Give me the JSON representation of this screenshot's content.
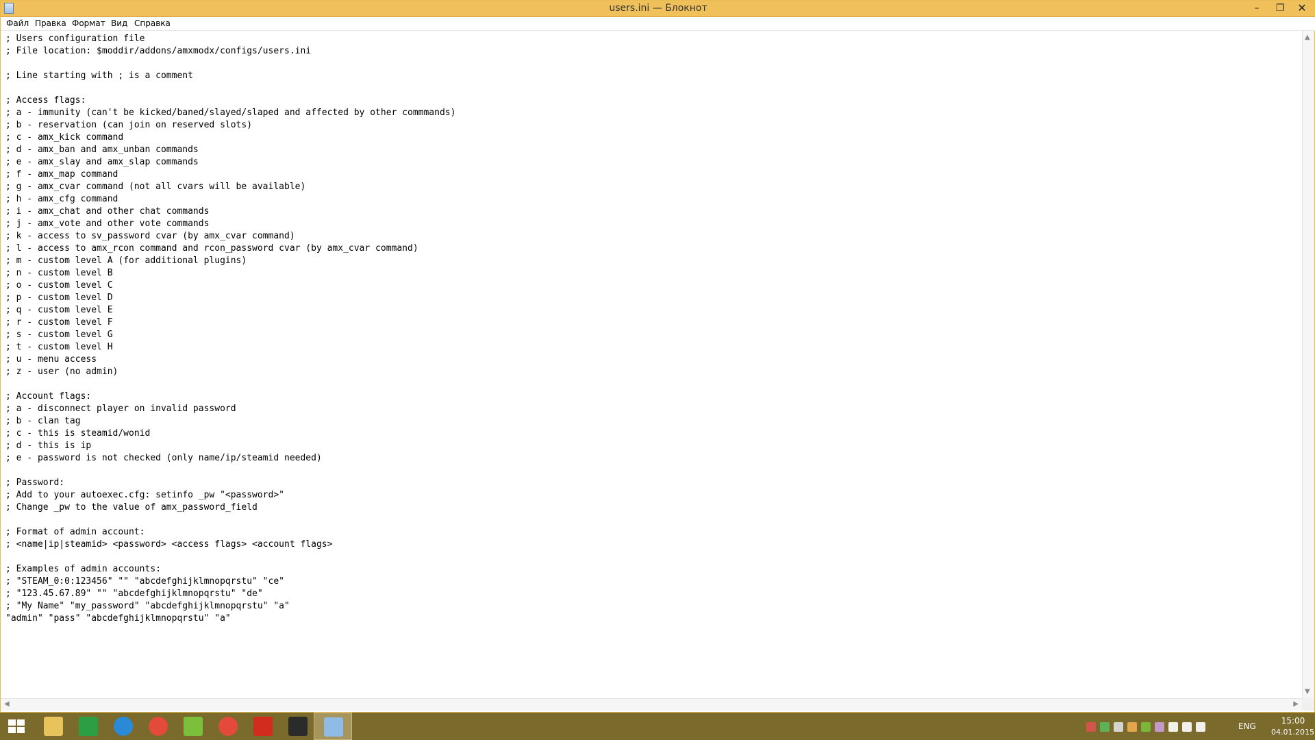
{
  "window": {
    "title": "users.ini — Блокнот",
    "controls": {
      "minimize": "–",
      "maximize": "❐",
      "close": "✕"
    }
  },
  "menu": {
    "items": [
      "Файл",
      "Правка",
      "Формат",
      "Вид",
      "Справка"
    ]
  },
  "editor": {
    "lines": [
      "; Users configuration file",
      "; File location: $moddir/addons/amxmodx/configs/users.ini",
      "",
      "; Line starting with ; is a comment",
      "",
      "; Access flags:",
      "; a - immunity (can't be kicked/baned/slayed/slaped and affected by other commmands)",
      "; b - reservation (can join on reserved slots)",
      "; c - amx_kick command",
      "; d - amx_ban and amx_unban commands",
      "; e - amx_slay and amx_slap commands",
      "; f - amx_map command",
      "; g - amx_cvar command (not all cvars will be available)",
      "; h - amx_cfg command",
      "; i - amx_chat and other chat commands",
      "; j - amx_vote and other vote commands",
      "; k - access to sv_password cvar (by amx_cvar command)",
      "; l - access to amx_rcon command and rcon_password cvar (by amx_cvar command)",
      "; m - custom level A (for additional plugins)",
      "; n - custom level B",
      "; o - custom level C",
      "; p - custom level D",
      "; q - custom level E",
      "; r - custom level F",
      "; s - custom level G",
      "; t - custom level H",
      "; u - menu access",
      "; z - user (no admin)",
      "",
      "; Account flags:",
      "; a - disconnect player on invalid password",
      "; b - clan tag",
      "; c - this is steamid/wonid",
      "; d - this is ip",
      "; e - password is not checked (only name/ip/steamid needed)",
      "",
      "; Password:",
      "; Add to your autoexec.cfg: setinfo _pw \"<password>\"",
      "; Change _pw to the value of amx_password_field",
      "",
      "; Format of admin account:",
      "; <name|ip|steamid> <password> <access flags> <account flags>",
      "",
      "; Examples of admin accounts:",
      "; \"STEAM_0:0:123456\" \"\" \"abcdefghijklmnopqrstu\" \"ce\"",
      "; \"123.45.67.89\" \"\" \"abcdefghijklmnopqrstu\" \"de\"",
      "; \"My Name\" \"my_password\" \"abcdefghijklmnopqrstu\" \"a\"",
      "\"admin\" \"pass\" \"abcdefghijklmnopqrstu\" \"a\""
    ]
  },
  "taskbar": {
    "color": "#7a6a2c",
    "pinned": [
      {
        "name": "file-explorer-icon",
        "color": "#e8c25a"
      },
      {
        "name": "store-icon",
        "color": "#2c9f45"
      },
      {
        "name": "mail-icon",
        "color": "#2a8ad8"
      },
      {
        "name": "chrome-icon",
        "color": "#e34a3b"
      },
      {
        "name": "utorrent-icon",
        "color": "#7bbf3a"
      },
      {
        "name": "chrome-icon",
        "color": "#e34a3b"
      },
      {
        "name": "half-life-icon",
        "color": "#d12c1e"
      },
      {
        "name": "counter-strike-icon",
        "color": "#2b2b2b"
      },
      {
        "name": "notepad-icon",
        "color": "#8fbce6"
      }
    ],
    "tray": {
      "language": "ENG",
      "time": "15:00",
      "date": "04.01.2015",
      "icons": [
        "kaspersky-icon",
        "nvidia-icon",
        "update-icon",
        "office-icon",
        "utorrent-icon",
        "app-icon",
        "flag-icon",
        "network-icon",
        "volume-icon"
      ]
    }
  }
}
